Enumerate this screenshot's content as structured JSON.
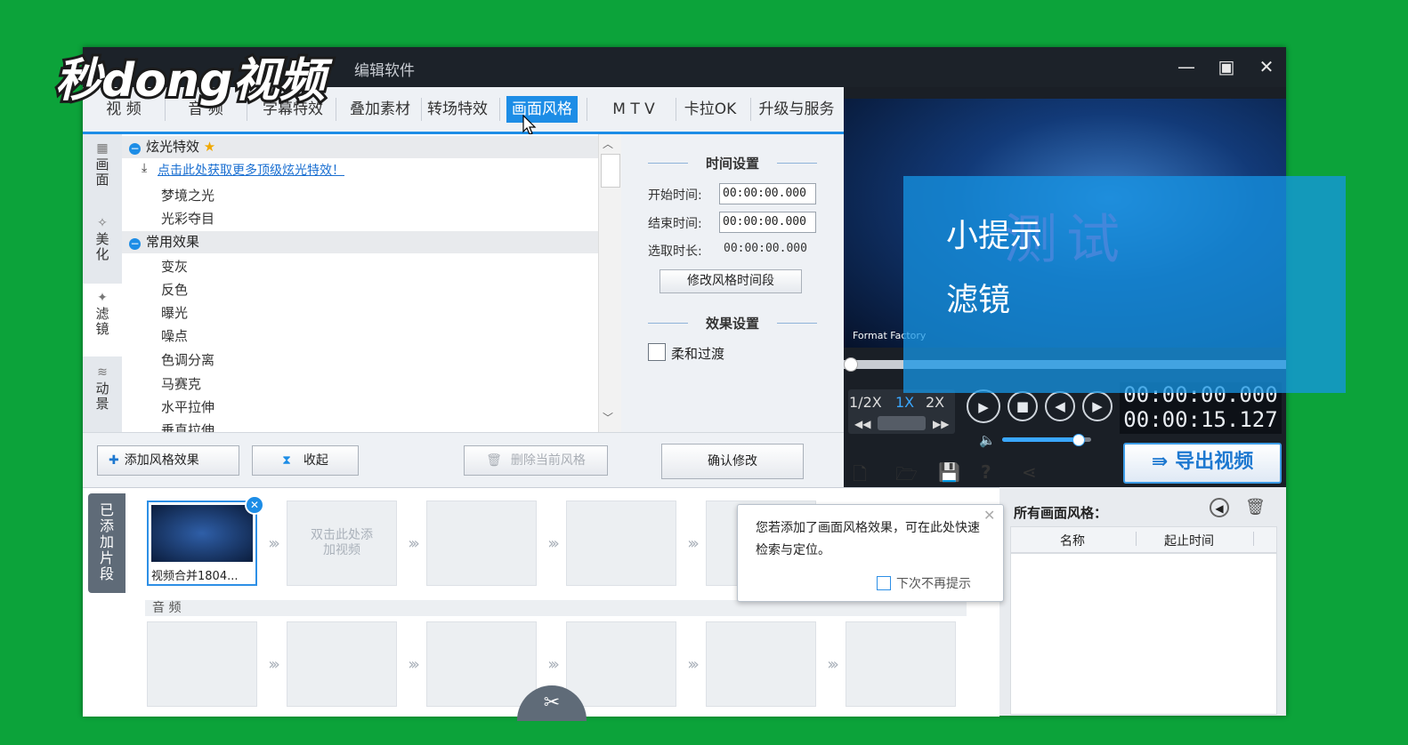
{
  "window": {
    "title_fragment": "编辑软件"
  },
  "logo": {
    "text": "秒dong视频"
  },
  "tabs": [
    {
      "label": "视  频"
    },
    {
      "label": "音  频"
    },
    {
      "label": "字幕特效"
    },
    {
      "label": "叠加素材"
    },
    {
      "label": "转场特效"
    },
    {
      "label": "画面风格"
    },
    {
      "label": "M T V"
    },
    {
      "label": "卡拉OK"
    },
    {
      "label": "升级与服务"
    }
  ],
  "side_tabs": [
    {
      "label": "画面"
    },
    {
      "label": "美化"
    },
    {
      "label": "滤镜"
    },
    {
      "label": "动景"
    }
  ],
  "effects": {
    "group1": "炫光特效",
    "link": "点击此处获取更多顶级炫光特效！",
    "group1_items": [
      "梦境之光",
      "光彩夺目"
    ],
    "group2": "常用效果",
    "group2_items": [
      "变灰",
      "反色",
      "曝光",
      "噪点",
      "色调分离",
      "马赛克",
      "水平拉伸",
      "垂直拉伸"
    ]
  },
  "settings": {
    "time_header": "时间设置",
    "start_label": "开始时间:",
    "start_value": "00:00:00.000",
    "end_label": "结束时间:",
    "end_value": "00:00:00.000",
    "dur_label": "选取时长:",
    "dur_value": "00:00:00.000",
    "modify_btn": "修改风格时间段",
    "effect_header": "效果设置",
    "soft_label": "柔和过渡",
    "confirm_btn": "确认修改"
  },
  "buttons": {
    "add": "添加风格效果",
    "collapse": "收起",
    "delete": "删除当前风格"
  },
  "player": {
    "tip_title": "小提示",
    "tip_sub": "滤镜",
    "video_text": "测试",
    "watermark": "Format Factory",
    "speeds": [
      "1/2X",
      "1X",
      "2X"
    ],
    "time_current": "00:00:00.000",
    "time_total": "00:00:15.127",
    "export": "导出视频",
    "volume": 0.85
  },
  "timeline": {
    "segments_label": "已添加片段",
    "clip_name": "视频合并1804...",
    "add_video_hint": "双击此处添加视频",
    "audio_label": "音 频"
  },
  "popup": {
    "text": "您若添加了画面风格效果，可在此处快速检索与定位。",
    "checkbox": "下次不再提示"
  },
  "stylelist": {
    "title": "所有画面风格：",
    "col_name": "名称",
    "col_time": "起止时间"
  },
  "colors": {
    "accent": "#1d8de6",
    "background": "#0ca33a"
  }
}
